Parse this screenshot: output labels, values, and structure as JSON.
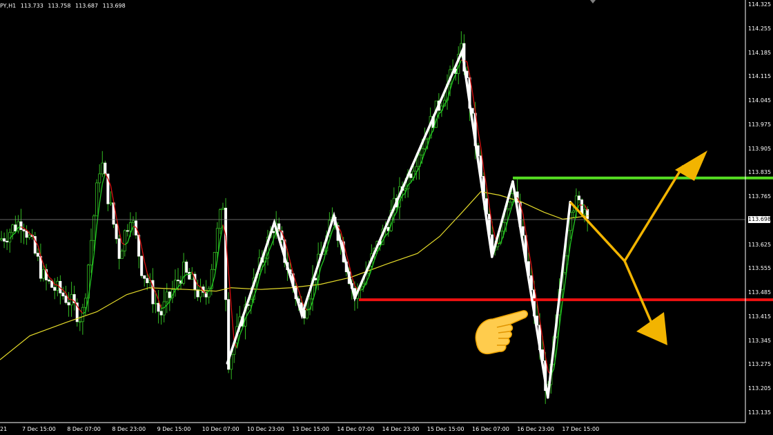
{
  "header": {
    "symbol": "PY,H1",
    "open": "113.733",
    "high": "113.758",
    "low": "113.687",
    "close": "113.698"
  },
  "current_price": "113.698",
  "corner_label": "21",
  "chart_data": {
    "type": "candlestick",
    "title": "",
    "xlabel": "",
    "ylabel": "",
    "ylim": [
      113.1,
      114.325
    ],
    "x_tick_labels": [
      "7 Dec 15:00",
      "8 Dec 07:00",
      "8 Dec 23:00",
      "9 Dec 15:00",
      "10 Dec 07:00",
      "10 Dec 23:00",
      "13 Dec 15:00",
      "14 Dec 07:00",
      "14 Dec 23:00",
      "15 Dec 15:00",
      "16 Dec 07:00",
      "16 Dec 23:00",
      "17 Dec 15:00"
    ],
    "y_tick_labels": [
      "114.325",
      "114.255",
      "114.185",
      "114.115",
      "114.045",
      "113.975",
      "113.905",
      "113.835",
      "113.765",
      "113.695",
      "113.625",
      "113.555",
      "113.485",
      "113.415",
      "113.345",
      "113.275",
      "113.205",
      "113.135"
    ],
    "zigzag": [
      {
        "x": 0.305,
        "y": 113.28
      },
      {
        "x": 0.368,
        "y": 113.69
      },
      {
        "x": 0.405,
        "y": 113.42
      },
      {
        "x": 0.448,
        "y": 113.71
      },
      {
        "x": 0.476,
        "y": 113.47
      },
      {
        "x": 0.62,
        "y": 114.19
      },
      {
        "x": 0.66,
        "y": 113.59
      },
      {
        "x": 0.688,
        "y": 113.81
      },
      {
        "x": 0.735,
        "y": 113.18
      },
      {
        "x": 0.765,
        "y": 113.75
      }
    ],
    "resistance_level": 113.82,
    "support_level": 113.465,
    "series_colors": {
      "zigzag": "#ffffff",
      "resistance": "#55dd22",
      "support": "#ee1111",
      "moving_average": "#e6dc2a",
      "bull_candle": "#33bb22",
      "bear_candle": "#ffffff",
      "fast_ma_up": "#22cc22",
      "fast_ma_down": "#dd1111",
      "projection_arrows": "#f2b400"
    },
    "grid": false,
    "annotations": [
      "pointing-hand",
      "up-arrow-projection",
      "down-arrow-projection"
    ]
  }
}
